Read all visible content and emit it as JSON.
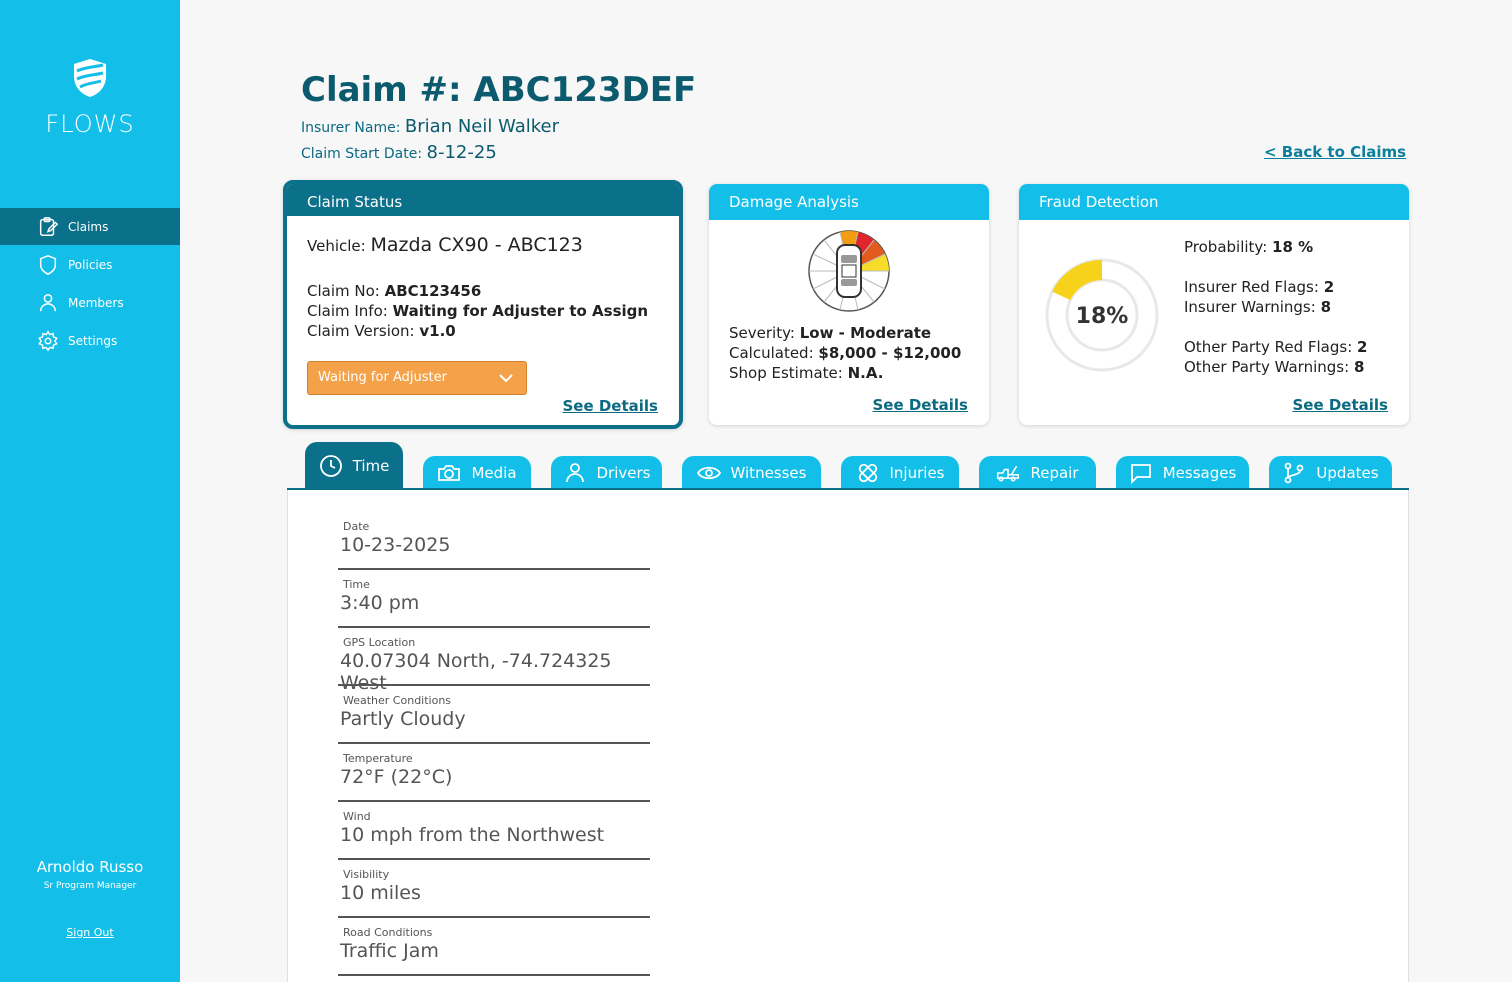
{
  "app": {
    "name": "FLOWS"
  },
  "sidebar": {
    "items": [
      {
        "label": "Claims",
        "icon": "clipboard-icon",
        "active": true
      },
      {
        "label": "Policies",
        "icon": "shield-icon",
        "active": false
      },
      {
        "label": "Members",
        "icon": "user-icon",
        "active": false
      },
      {
        "label": "Settings",
        "icon": "gear-icon",
        "active": false
      }
    ],
    "user_name": "Arnoldo Russo",
    "user_role": "Sr Program Manager",
    "sign_out": "Sign Out"
  },
  "header": {
    "title": "Claim #: ABC123DEF",
    "insurer_label": "Insurer Name:",
    "insurer_value": "Brian Neil Walker",
    "start_label": "Claim Start Date:",
    "start_value": "8-12-25",
    "back_link": "< Back to Claims"
  },
  "claim_status": {
    "title": "Claim Status",
    "vehicle_label": "Vehicle:",
    "vehicle_value": "Mazda CX90 - ABC123",
    "claim_no_label": "Claim No:",
    "claim_no_value": "ABC123456",
    "claim_info_label": "Claim Info:",
    "claim_info_value": "Waiting for Adjuster to Assign",
    "claim_version_label": "Claim Version:",
    "claim_version_value": "v1.0",
    "dropdown_value": "Waiting for Adjuster",
    "see_details": "See Details"
  },
  "damage": {
    "title": "Damage Analysis",
    "severity_label": "Severity:",
    "severity_value": "Low - Moderate",
    "calculated_label": "Calculated:",
    "calculated_value": "$8,000 - $12,000",
    "shop_label": "Shop Estimate:",
    "shop_value": "N.A.",
    "see_details": "See Details",
    "damage_colors": {
      "orange": "#f39c12",
      "red": "#e0262b",
      "yellow": "#f7dc2a"
    }
  },
  "fraud": {
    "title": "Fraud Detection",
    "percent_text": "18%",
    "percent_value": 18,
    "probability_label": "Probability:",
    "probability_value": "18 %",
    "insurer_flags_label": "Insurer Red Flags:",
    "insurer_flags_value": "2",
    "insurer_warnings_label": "Insurer Warnings:",
    "insurer_warnings_value": "8",
    "other_flags_label": "Other Party Red Flags:",
    "other_flags_value": "2",
    "other_warnings_label": "Other Party Warnings:",
    "other_warnings_value": "8",
    "see_details": "See Details",
    "gauge_color": "#f7d21a"
  },
  "tabs": [
    {
      "label": "Time",
      "icon": "clock-icon",
      "active": true
    },
    {
      "label": "Media",
      "icon": "camera-icon"
    },
    {
      "label": "Drivers",
      "icon": "user-icon"
    },
    {
      "label": "Witnesses",
      "icon": "eye-icon"
    },
    {
      "label": "Injuries",
      "icon": "bandage-icon"
    },
    {
      "label": "Repair",
      "icon": "tow-truck-icon"
    },
    {
      "label": "Messages",
      "icon": "chat-icon"
    },
    {
      "label": "Updates",
      "icon": "branch-icon"
    }
  ],
  "fields": [
    {
      "label": "Date",
      "value": "10-23-2025"
    },
    {
      "label": "Time",
      "value": "3:40 pm"
    },
    {
      "label": "GPS Location",
      "value": "40.07304 North, -74.724325 West"
    },
    {
      "label": "Weather Conditions",
      "value": "Partly Cloudy"
    },
    {
      "label": "Temperature",
      "value": "72°F (22°C)"
    },
    {
      "label": "Wind",
      "value": "10 mph from the Northwest"
    },
    {
      "label": "Visibility",
      "value": "10 miles"
    },
    {
      "label": "Road Conditions",
      "value": "Traffic Jam"
    }
  ],
  "colors": {
    "primary": "#13bfe8",
    "dark": "#0b7089",
    "accent_orange": "#f4a24a"
  }
}
